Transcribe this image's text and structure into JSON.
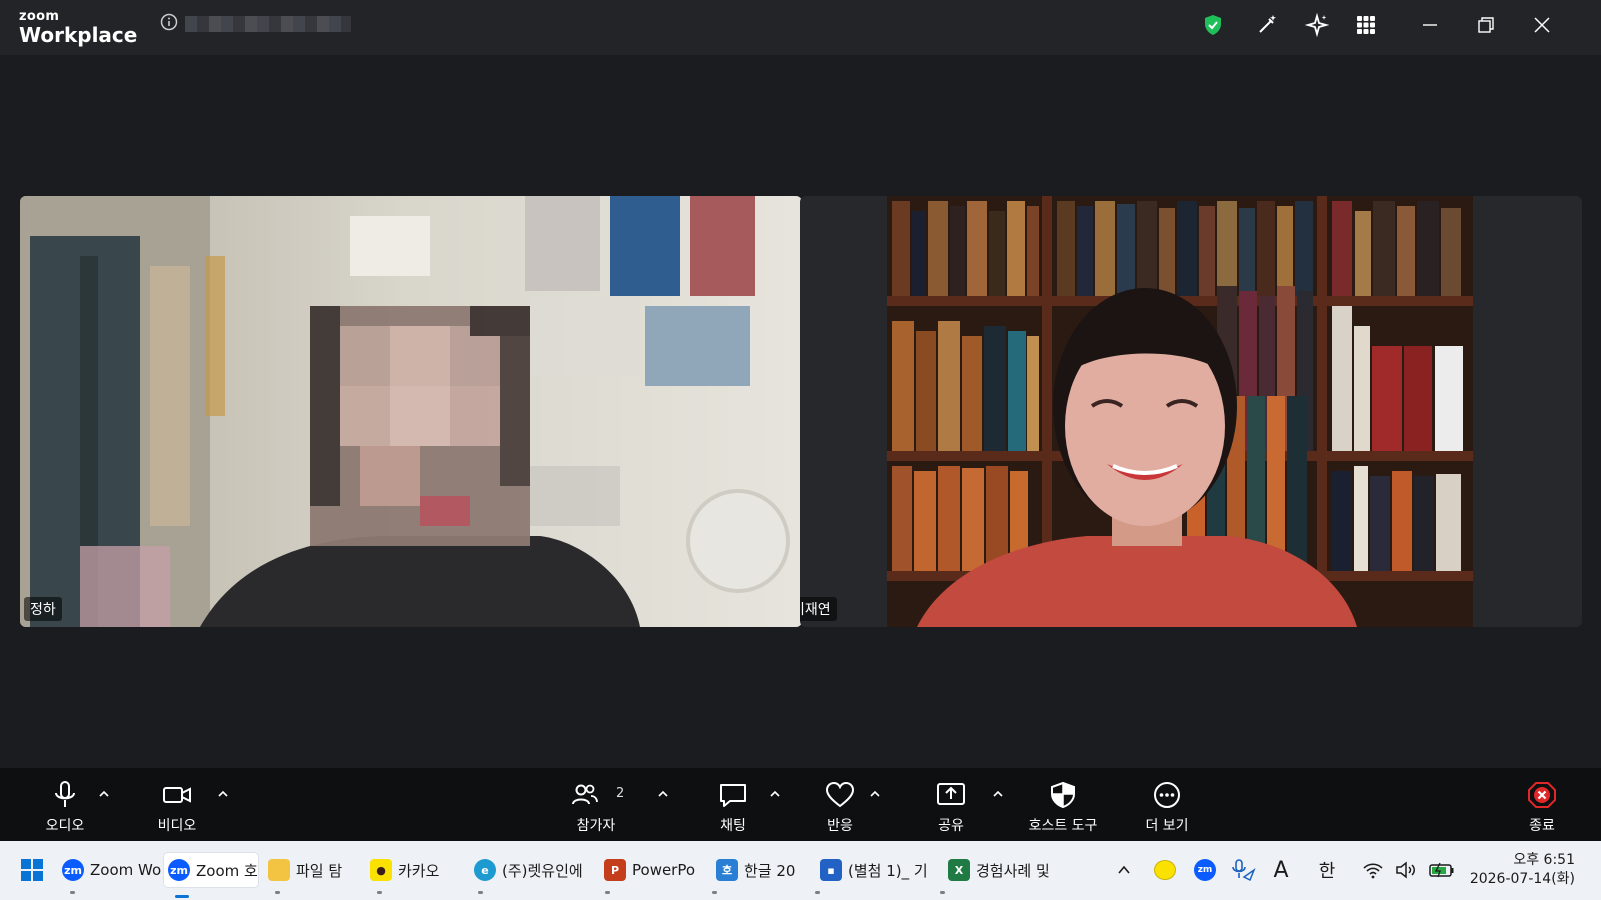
{
  "app": {
    "logo_small": "zoom",
    "logo_large": "Workplace"
  },
  "participants": [
    {
      "name": "정하"
    },
    {
      "name": "이재연"
    }
  ],
  "toolbar": {
    "audio": "오디오",
    "video": "비디오",
    "participants": "참가자",
    "participants_count": "2",
    "chat": "채팅",
    "react": "반응",
    "share": "공유",
    "host_tools": "호스트 도구",
    "more": "더 보기",
    "end": "종료"
  },
  "taskbar": {
    "items": [
      {
        "label": "Zoom Wo",
        "icon": "zoom-icon"
      },
      {
        "label": "Zoom 호",
        "icon": "zoom-icon"
      },
      {
        "label": "파일 탐",
        "icon": "folder-icon"
      },
      {
        "label": "카카오",
        "icon": "kakaotalk-icon"
      },
      {
        "label": "(주)렛유인에",
        "icon": "edge-icon"
      },
      {
        "label": "PowerPo",
        "icon": "powerpoint-icon"
      },
      {
        "label": "한글 20",
        "icon": "hangul-icon"
      },
      {
        "label": "(별첨 1)_ 기",
        "icon": "hwp-doc-icon"
      },
      {
        "label": "경험사례 및",
        "icon": "excel-icon"
      }
    ],
    "ime_a": "A",
    "ime_han": "한",
    "time": "오후 6:51",
    "date": "2026-07-14(화)"
  },
  "colors": {
    "accent_zoom": "#0b5cff",
    "end_red": "#e02828",
    "shield_green": "#1fbf5a"
  }
}
